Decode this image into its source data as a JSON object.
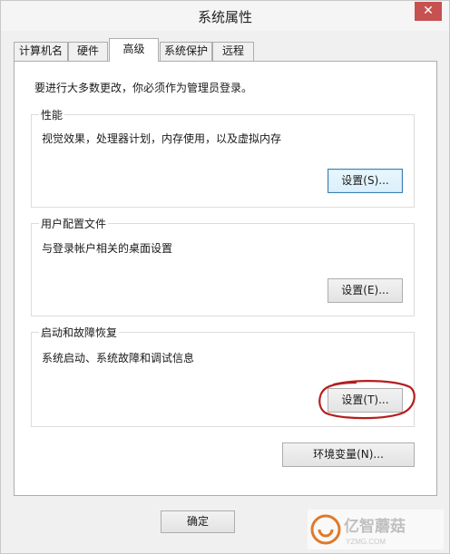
{
  "window": {
    "title": "系统属性",
    "close_label": "✕"
  },
  "tabs": [
    {
      "label": "计算机名"
    },
    {
      "label": "硬件"
    },
    {
      "label": "高级"
    },
    {
      "label": "系统保护"
    },
    {
      "label": "远程"
    }
  ],
  "notice": "要进行大多数更改，你必须作为管理员登录。",
  "performance": {
    "title": "性能",
    "description": "视觉效果，处理器计划，内存使用，以及虚拟内存",
    "button": "设置(S)..."
  },
  "user_profiles": {
    "title": "用户配置文件",
    "description": "与登录帐户相关的桌面设置",
    "button": "设置(E)..."
  },
  "startup_recovery": {
    "title": "启动和故障恢复",
    "description": "系统启动、系统故障和调试信息",
    "button": "设置(T)..."
  },
  "env_button": "环境变量(N)...",
  "footer": {
    "ok_label": "确定"
  },
  "watermark": {
    "text": "亿智蘑菇",
    "sub": "YZMG.COM"
  },
  "colors": {
    "annotation": "#b41e1e",
    "close_bg": "#c75050"
  }
}
